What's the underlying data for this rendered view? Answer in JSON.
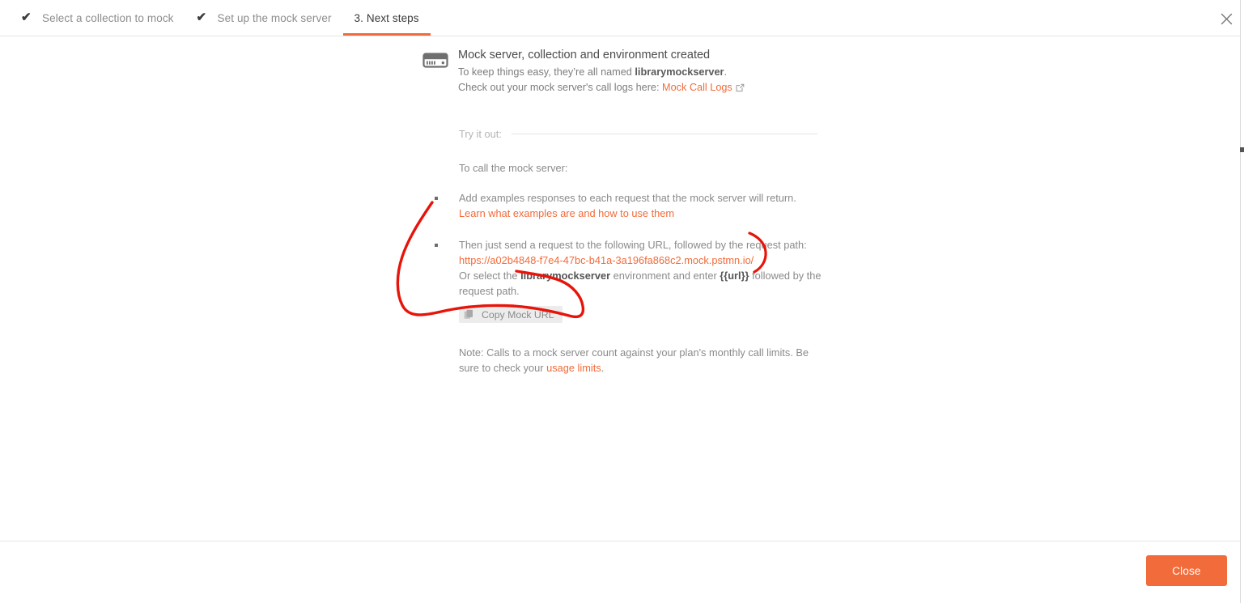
{
  "window": {
    "close_icon": "close-icon"
  },
  "wizard": {
    "tabs": [
      {
        "label": "Select a collection to mock",
        "state": "done",
        "check": "✔"
      },
      {
        "label": "Set up the mock server",
        "state": "done",
        "check": "✔"
      },
      {
        "label": "3. Next steps",
        "state": "active",
        "check": ""
      }
    ]
  },
  "main": {
    "icon": "server-icon",
    "title": "Mock server, collection and environment created",
    "subtitle_prefix": "To keep things easy, they’re all named ",
    "subtitle_name": "librarymockserver",
    "subtitle_suffix": ".",
    "logs_prefix": "Check out your mock server's call logs here: ",
    "logs_link": "Mock Call Logs",
    "try_it_out": "Try it out:",
    "to_call": "To call the mock server:",
    "steps": [
      {
        "text": "Add examples responses to each request that the mock server will return.",
        "link": "Learn what examples are and how to use them"
      },
      {
        "text": "Then just send a request to the following URL, followed by the request path:",
        "url": "https://a02b4848-f7e4-47bc-b41a-3a196fa868c2.mock.pstmn.io/",
        "or_prefix": "Or select the ",
        "or_env": "librarymockserver",
        "or_mid": " environment and enter ",
        "or_var": "{{url}}",
        "or_suffix": " followed by the request path.",
        "copy_button": "Copy Mock URL",
        "copy_icon": "copy-icon"
      }
    ],
    "note_prefix": "Note: Calls to a mock server count against your plan's monthly call limits. Be sure to check your ",
    "note_link": "usage limits",
    "note_suffix": "."
  },
  "footer": {
    "close_label": "Close"
  },
  "colors": {
    "accent": "#f26b3a",
    "annotation": "#e8140a",
    "text_muted": "#8a8a8a",
    "button_bg": "#ececec"
  }
}
